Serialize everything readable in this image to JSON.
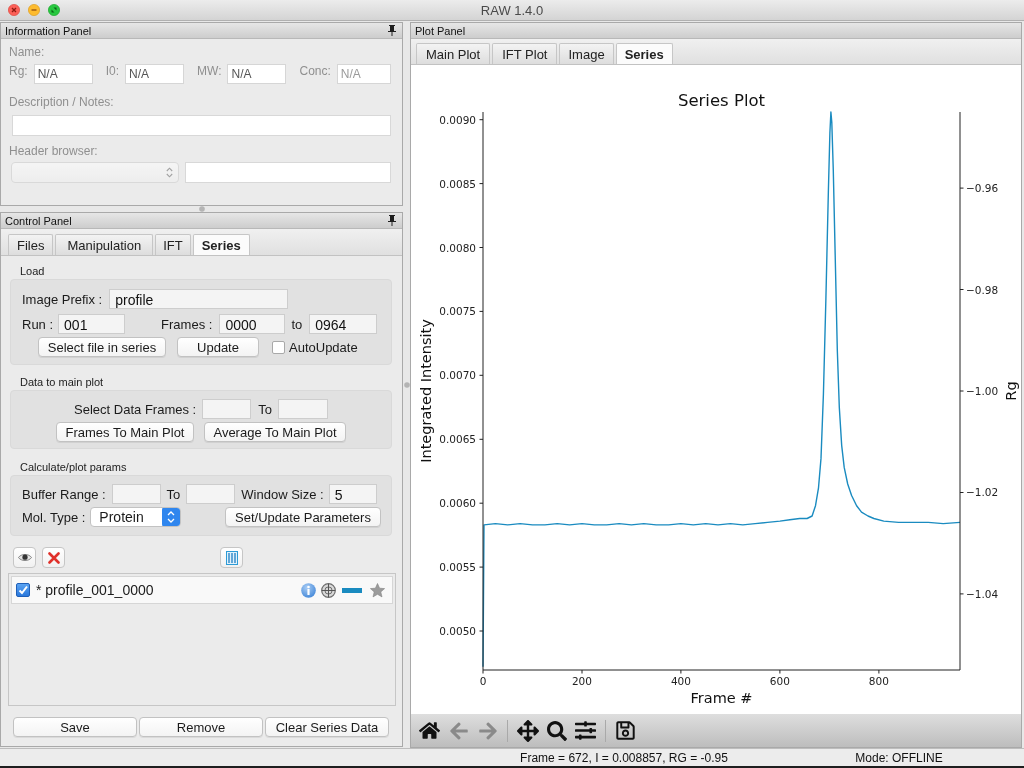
{
  "window": {
    "title": "RAW 1.4.0"
  },
  "information_panel": {
    "title": "Information Panel",
    "disabled": true,
    "name_label": "Name:",
    "fields": [
      {
        "label": "Rg:",
        "value": "N/A",
        "disabled": false
      },
      {
        "label": "I0:",
        "value": "N/A",
        "disabled": false
      },
      {
        "label": "MW:",
        "value": "N/A",
        "disabled": false
      },
      {
        "label": "Conc:",
        "value": "N/A",
        "disabled": true
      }
    ],
    "notes_label": "Description / Notes:",
    "header_browser_label": "Header browser:"
  },
  "control_panel": {
    "title": "Control Panel",
    "tabs": [
      {
        "label": "Files",
        "selected": false
      },
      {
        "label": "Manipulation",
        "selected": false
      },
      {
        "label": "IFT",
        "selected": false
      },
      {
        "label": "Series",
        "selected": true
      }
    ],
    "load": {
      "title": "Load",
      "image_prefix_label": "Image Prefix :",
      "image_prefix": "profile",
      "run_label": "Run :",
      "run": "001",
      "frames_label": "Frames :",
      "frames_from": "0000",
      "to_label": "to",
      "frames_to": "0964",
      "buttons": [
        "Select file in series",
        "Update"
      ],
      "autoupdate": {
        "label": "AutoUpdate",
        "checked": false
      }
    },
    "data_to_main_plot": {
      "title": "Data to main plot",
      "select_label": "Select Data Frames :",
      "to_label": "To",
      "buttons": [
        "Frames To Main Plot",
        "Average To Main Plot"
      ]
    },
    "params": {
      "title": "Calculate/plot params",
      "buffer_range_label": "Buffer Range :",
      "to_label": "To",
      "window_size_label": "Window Size :",
      "window_size": "5",
      "mol_type_label": "Mol. Type :",
      "mol_type": "Protein",
      "button": "Set/Update Parameters"
    },
    "series_list": [
      {
        "name": "* profile_001_0000",
        "checked": true,
        "color": "#1a8bc0"
      }
    ],
    "buttons": [
      "Save",
      "Remove",
      "Clear Series Data"
    ]
  },
  "plot_panel": {
    "title": "Plot Panel",
    "tabs": [
      {
        "label": "Main Plot",
        "selected": false
      },
      {
        "label": "IFT Plot",
        "selected": false
      },
      {
        "label": "Image",
        "selected": false
      },
      {
        "label": "Series",
        "selected": true
      }
    ],
    "chart_data": {
      "type": "line",
      "title": "Series Plot",
      "xlabel": "Frame #",
      "ylabel": "Integrated Intensity",
      "x": [
        0,
        2,
        25,
        50,
        75,
        100,
        125,
        150,
        175,
        200,
        225,
        250,
        275,
        300,
        325,
        350,
        375,
        400,
        425,
        450,
        475,
        500,
        525,
        550,
        575,
        600,
        620,
        640,
        655,
        665,
        672,
        678,
        683,
        688,
        693,
        698,
        701,
        703,
        705,
        708,
        712,
        716,
        720,
        725,
        730,
        737,
        745,
        755,
        765,
        778,
        790,
        810,
        840,
        870,
        900,
        930,
        964
      ],
      "series": [
        {
          "color": "#1a8bc0",
          "values": [
            0.00472,
            0.00583,
            0.00584,
            0.00583,
            0.00584,
            0.00583,
            0.00583,
            0.00584,
            0.00583,
            0.00584,
            0.00583,
            0.00583,
            0.00584,
            0.00583,
            0.00584,
            0.00583,
            0.00583,
            0.00584,
            0.00583,
            0.00584,
            0.00583,
            0.00584,
            0.00583,
            0.00584,
            0.00585,
            0.00586,
            0.00587,
            0.00588,
            0.00588,
            0.0059,
            0.00598,
            0.00612,
            0.00635,
            0.00685,
            0.0076,
            0.00845,
            0.0089,
            0.00906,
            0.00898,
            0.0086,
            0.0079,
            0.0072,
            0.00675,
            0.00645,
            0.00628,
            0.00615,
            0.00606,
            0.00598,
            0.00593,
            0.0059,
            0.00588,
            0.00586,
            0.00585,
            0.00585,
            0.00585,
            0.00584,
            0.00585
          ]
        }
      ],
      "xlim": [
        0,
        964
      ],
      "ylim": [
        0.004695,
        0.00906
      ],
      "xticks": [
        0,
        200,
        400,
        600,
        800
      ],
      "yticks": [
        {
          "value": 0.005,
          "label": "0.0050"
        },
        {
          "value": 0.0055,
          "label": "0.0055"
        },
        {
          "value": 0.006,
          "label": "0.0060"
        },
        {
          "value": 0.0065,
          "label": "0.0065"
        },
        {
          "value": 0.007,
          "label": "0.0070"
        },
        {
          "value": 0.0075,
          "label": "0.0075"
        },
        {
          "value": 0.008,
          "label": "0.0080"
        },
        {
          "value": 0.0085,
          "label": "0.0085"
        },
        {
          "value": 0.009,
          "label": "0.0090"
        }
      ],
      "y2label": "Rg",
      "y2lim": [
        -1.055,
        -0.945
      ],
      "y2ticks": [
        {
          "value": -1.04,
          "label": "−1.04"
        },
        {
          "value": -1.02,
          "label": "−1.02"
        },
        {
          "value": -1.0,
          "label": "−1.00"
        },
        {
          "value": -0.98,
          "label": "−0.98"
        },
        {
          "value": -0.96,
          "label": "−0.96"
        }
      ]
    },
    "toolbar": {
      "back_enabled": false,
      "forward_enabled": false
    }
  },
  "status_bar": {
    "readout": "Frame = 672, I = 0.008857, RG = -0.95",
    "mode": "Mode: OFFLINE"
  }
}
